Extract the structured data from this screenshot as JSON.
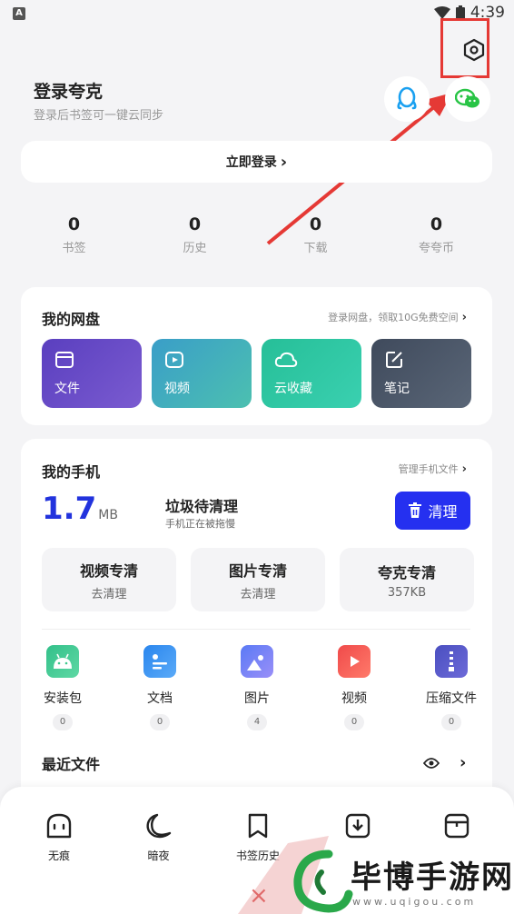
{
  "status_bar": {
    "time": "4:39",
    "left_badge": "A"
  },
  "header": {
    "title": "登录夸克",
    "subtitle": "登录后书签可一键云同步"
  },
  "login_button": {
    "label": "立即登录",
    "arrow": "›"
  },
  "stats": [
    {
      "value": "0",
      "label": "书签"
    },
    {
      "value": "0",
      "label": "历史"
    },
    {
      "value": "0",
      "label": "下载"
    },
    {
      "value": "0",
      "label": "夸夸币"
    }
  ],
  "cloud_disk": {
    "title": "我的网盘",
    "link": "登录网盘，领取10G免费空间",
    "tiles": [
      {
        "label": "文件",
        "color": "#6a4fc4",
        "icon": "folder-icon"
      },
      {
        "label": "视频",
        "color": "#3fb0b8",
        "icon": "play-icon"
      },
      {
        "label": "云收藏",
        "color": "#2ec4a0",
        "icon": "cloud-icon"
      },
      {
        "label": "笔记",
        "color": "#4a5566",
        "icon": "note-icon"
      }
    ]
  },
  "my_phone": {
    "title": "我的手机",
    "link": "管理手机文件",
    "junk_size": "1.7",
    "junk_unit": "MB",
    "junk_title": "垃圾待清理",
    "junk_sub": "手机正在被拖慢",
    "clean_label": "清理",
    "subcards": [
      {
        "title": "视频专清",
        "sub": "去清理"
      },
      {
        "title": "图片专清",
        "sub": "去清理"
      },
      {
        "title": "夸克专清",
        "sub": "357KB"
      }
    ],
    "file_types": [
      {
        "label": "安装包",
        "count": "0",
        "icon": "android-icon",
        "color": "#3ec98e"
      },
      {
        "label": "文档",
        "count": "0",
        "icon": "document-icon",
        "color": "#3a8ef0"
      },
      {
        "label": "图片",
        "count": "4",
        "icon": "image-icon",
        "color": "#6f7ff5"
      },
      {
        "label": "视频",
        "count": "0",
        "icon": "video-icon",
        "color": "#f04a4a"
      },
      {
        "label": "压缩文件",
        "count": "0",
        "icon": "zip-icon",
        "color": "#5b5fc7"
      }
    ]
  },
  "recent": {
    "title": "最近文件"
  },
  "bottom_nav": [
    {
      "label": "无痕",
      "icon": "incognito-icon"
    },
    {
      "label": "暗夜",
      "icon": "moon-icon"
    },
    {
      "label": "书签历史",
      "icon": "bookmark-icon"
    },
    {
      "label": "",
      "icon": "download-icon"
    },
    {
      "label": "",
      "icon": "tabs-icon"
    }
  ],
  "watermark": {
    "text": "毕博手游网",
    "url": "www.uqigou.com"
  },
  "colors": {
    "accent": "#2530f0",
    "annotation": "#e53935",
    "bg": "#f4f4f6"
  }
}
